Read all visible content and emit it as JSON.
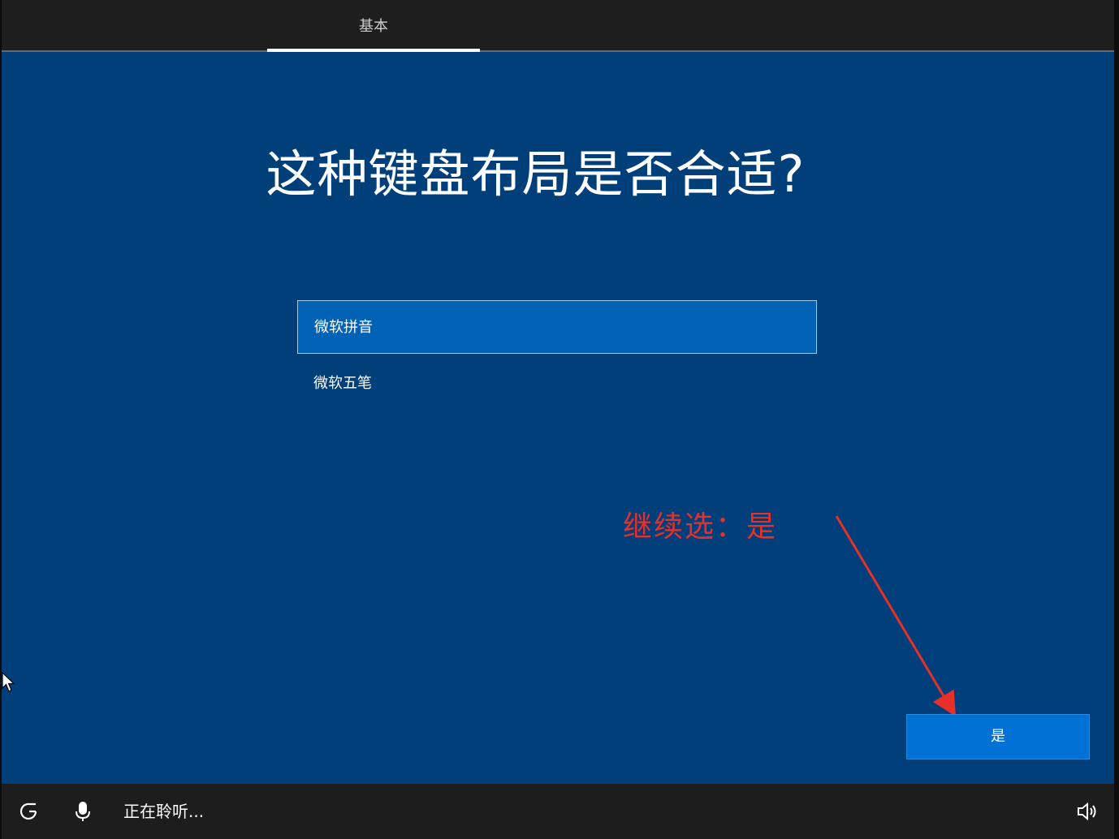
{
  "topbar": {
    "tab_basics": "基本"
  },
  "main": {
    "heading": "这种键盘布局是否合适?",
    "options": [
      {
        "label": "微软拼音",
        "selected": true
      },
      {
        "label": "微软五笔",
        "selected": false
      }
    ],
    "annotation": "继续选：是",
    "annotation_color": "#e8302a",
    "yes_button": "是"
  },
  "bottombar": {
    "listening": "正在聆听...",
    "icons": [
      "ease-of-access-icon",
      "microphone-icon",
      "volume-icon"
    ]
  },
  "colors": {
    "background": "#003f7a",
    "selected_option": "#0062b5",
    "primary_button": "#0072d6"
  }
}
